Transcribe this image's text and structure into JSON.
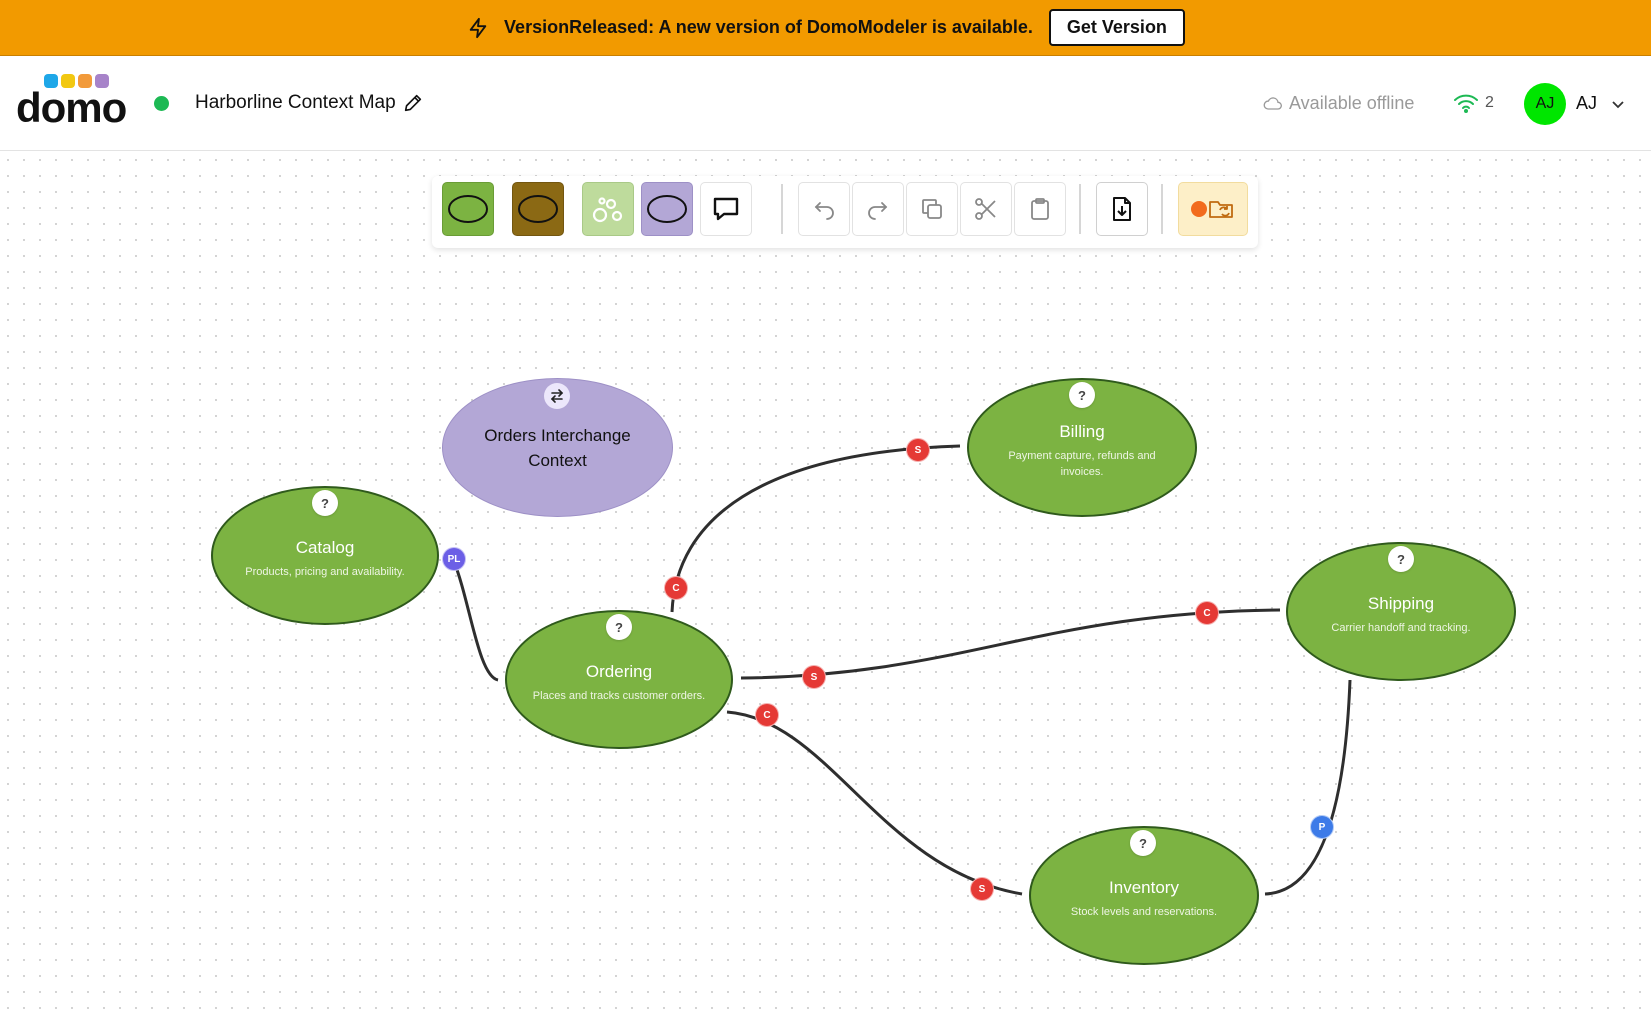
{
  "banner": {
    "message": "VersionReleased: A new version of DomoModeler is available.",
    "button_label": "Get Version",
    "background": "#f29a00"
  },
  "header": {
    "logo_text": "domo",
    "logo_dot_colors": [
      "#1ea7e8",
      "#f2c811",
      "#f29a3a",
      "#a783c9"
    ],
    "project_title": "Harborline Context Map",
    "status_color": "#1db954",
    "offline_label": "Available offline",
    "connection_count": "2",
    "user_initials": "AJ",
    "user_name": "AJ",
    "avatar_color": "#00e600"
  },
  "toolbar": {
    "tools": [
      "bounded-context",
      "external-system",
      "domain-events",
      "interchange-context",
      "comment"
    ],
    "actions": [
      "undo",
      "redo",
      "copy",
      "cut",
      "paste",
      "export",
      "record-sync"
    ],
    "colors": {
      "context": "#7cb342",
      "external": "#8b6914",
      "events": "#bedb9c",
      "interchange": "#b3a7d6"
    }
  },
  "contexts": [
    {
      "id": "catalog",
      "name": "Catalog",
      "description": "Products, pricing and availability.",
      "help": "?"
    },
    {
      "id": "ordering",
      "name": "Ordering",
      "description": "Places and tracks customer orders.",
      "help": "?"
    },
    {
      "id": "billing",
      "name": "Billing",
      "description": "Payment capture, refunds and invoices.",
      "help": "?"
    },
    {
      "id": "shipping",
      "name": "Shipping",
      "description": "Carrier handoff and tracking.",
      "help": "?"
    },
    {
      "id": "inventory",
      "name": "Inventory",
      "description": "Stock levels and reservations.",
      "help": "?"
    }
  ],
  "interchange": {
    "name": "Orders Interchange Context"
  },
  "relations": [
    {
      "from": "catalog",
      "to": "ordering",
      "badges": [
        "PL"
      ]
    },
    {
      "from": "ordering",
      "to": "billing",
      "badges": [
        "C",
        "S"
      ]
    },
    {
      "from": "ordering",
      "to": "shipping",
      "badges": [
        "S",
        "C"
      ]
    },
    {
      "from": "ordering",
      "to": "inventory",
      "badges": [
        "C",
        "S"
      ]
    },
    {
      "from": "shipping",
      "to": "inventory",
      "badges": [
        "P"
      ]
    }
  ]
}
